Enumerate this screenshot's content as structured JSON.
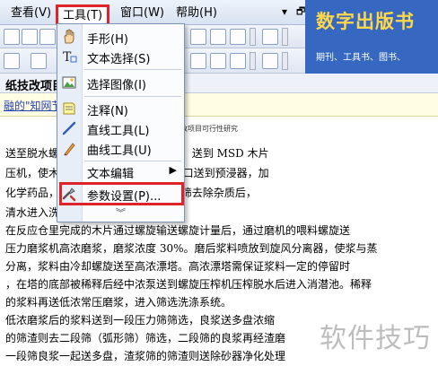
{
  "menubar": {
    "view": "查看(V)",
    "tools": "工具(T)",
    "window": "窗口(W)",
    "help": "帮助(H)",
    "minimize": "▾",
    "restore": "🗗"
  },
  "banner": {
    "title": "数字出版书",
    "subtitle": "期刊、工具书、图书、"
  },
  "document": {
    "title": "纸技改项目",
    "link_text": "融的\"知网节\"",
    "page_header": "纸技改项目可行性研究",
    "lines": [
      "送至脱水螺                    在预汽蒸仓内被加热软化，送到 MSD 木片",
      "压机，使木                    挤压后的木片从 MSD 出口送到预浸器，加",
      "化学药品，                    片洗涤系统的废水通过斜筛去除杂质后，",
      "清水进入洗                    洗涤系统。",
      "    在反应仓里完成的木片通过螺旋输送螺旋计量后，通过磨机的喂料螺旋送",
      "压力磨浆机高浓磨浆，磨浆浓度 30%。磨后浆料喷放到旋风分离器，使浆与蒸",
      "分离，浆料由冷却螺旋送至高浓漂塔。高浓漂塔需保证浆料一定的停留时",
      "，在塔的底部被稀释后经中浓泵送到螺旋压榨机压榨脱水后进入消潜池。稀释",
      "的浆料再送低浓常压磨浆，进入筛选洗涤系统。",
      "    低浓磨浆后的浆料送到一段压力筛筛选，良浆送多盘浓缩",
      "的筛渣则去二段筛（弧形筛）筛选，二段筛的良浆再经渣磨",
      "一段筛良浆一起送多盘，渣浆筛的筛渣则送除砂器净化处理"
    ]
  },
  "tools_menu": {
    "items": [
      {
        "label": "手形(H)",
        "icon": "hand-icon"
      },
      {
        "label": "文本选择(S)",
        "icon": "text-select-icon"
      },
      {
        "label": "选择图像(I)",
        "icon": "select-image-icon"
      },
      {
        "label": "注释(N)",
        "icon": "annotation-icon"
      },
      {
        "label": "直线工具(L)",
        "icon": "line-tool-icon"
      },
      {
        "label": "曲线工具(U)",
        "icon": "curve-tool-icon"
      },
      {
        "label": "文本编辑",
        "icon": "",
        "submenu_arrow": "▶"
      },
      {
        "label": "参数设置(P)...",
        "icon": "settings-icon"
      }
    ],
    "more": "︾"
  },
  "watermark": "软件技巧",
  "colors": {
    "highlight_border": "#e0232b",
    "banner_bg": "#3768c1",
    "banner_title": "#ffd84a",
    "link": "#2741b8"
  }
}
